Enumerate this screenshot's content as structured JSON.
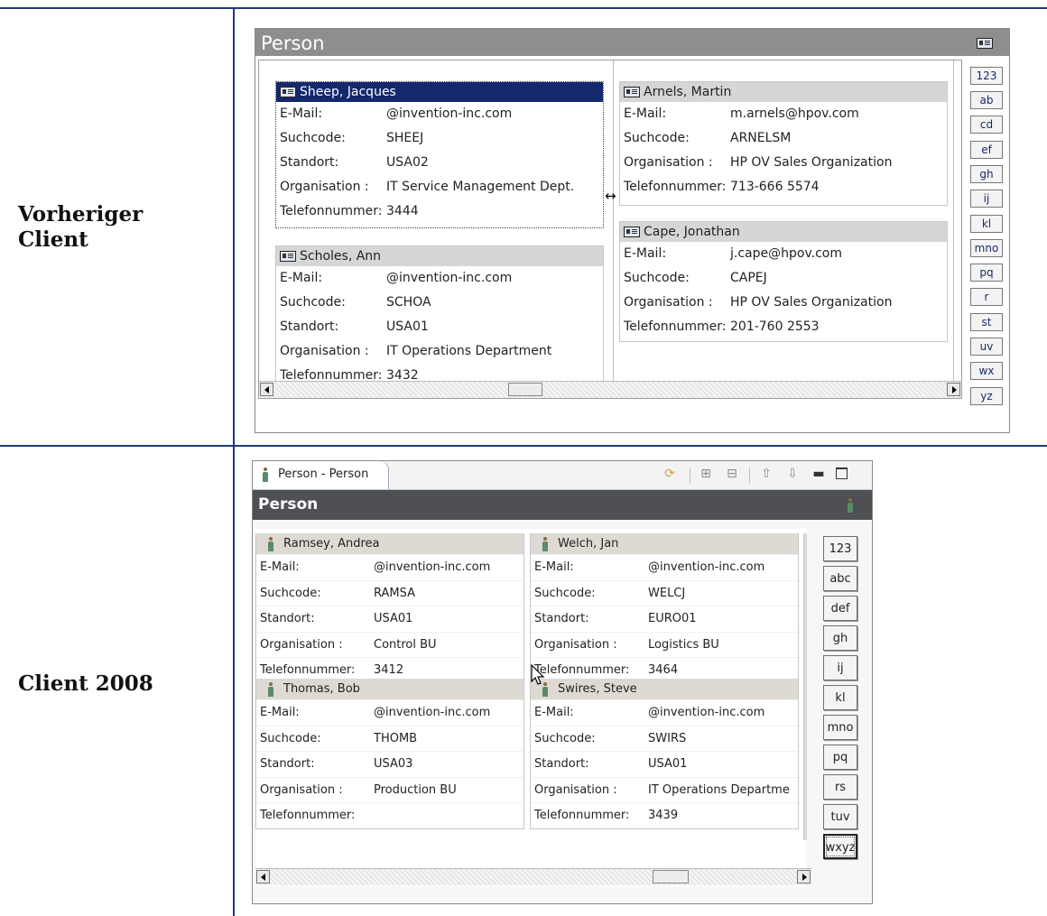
{
  "rows": [
    {
      "label_line1": "Vorheriger",
      "label_line2": "Client"
    },
    {
      "label_line1": "Client 2008"
    }
  ],
  "old_client": {
    "title": "Person",
    "cards": [
      {
        "name": "Sheep, Jacques",
        "selected": true,
        "fields": [
          {
            "k": "E-Mail:",
            "v": "@invention-inc.com"
          },
          {
            "k": "Suchcode:",
            "v": "SHEEJ"
          },
          {
            "k": "Standort:",
            "v": "USA02"
          },
          {
            "k": "Organisation :",
            "v": "IT Service Management Dept."
          },
          {
            "k": "Telefonnummer:",
            "v": "3444"
          }
        ]
      },
      {
        "name": "Scholes, Ann",
        "selected": false,
        "fields": [
          {
            "k": "E-Mail:",
            "v": "@invention-inc.com"
          },
          {
            "k": "Suchcode:",
            "v": "SCHOA"
          },
          {
            "k": "Standort:",
            "v": "USA01"
          },
          {
            "k": "Organisation :",
            "v": "IT Operations Department"
          },
          {
            "k": "Telefonnummer:",
            "v": "3432"
          }
        ]
      },
      {
        "name": "Arnels, Martin",
        "selected": false,
        "fields": [
          {
            "k": "E-Mail:",
            "v": "m.arnels@hpov.com"
          },
          {
            "k": "Suchcode:",
            "v": "ARNELSM"
          },
          {
            "k": "Organisation :",
            "v": "HP OV Sales Organization"
          },
          {
            "k": "Telefonnummer:",
            "v": "713-666 5574"
          }
        ]
      },
      {
        "name": "Cape, Jonathan",
        "selected": false,
        "fields": [
          {
            "k": "E-Mail:",
            "v": "j.cape@hpov.com"
          },
          {
            "k": "Suchcode:",
            "v": "CAPEJ"
          },
          {
            "k": "Organisation :",
            "v": "HP OV Sales Organization"
          },
          {
            "k": "Telefonnummer:",
            "v": "201-760 2553"
          }
        ]
      }
    ],
    "index": [
      "123",
      "ab",
      "cd",
      "ef",
      "gh",
      "ij",
      "kl",
      "mno",
      "pq",
      "r",
      "st",
      "uv",
      "wx",
      "yz"
    ]
  },
  "new_client": {
    "tab_label": "Person - Person",
    "title": "Person",
    "cards": [
      {
        "name": "Ramsey, Andrea",
        "fields": [
          {
            "k": "E-Mail:",
            "v": "@invention-inc.com"
          },
          {
            "k": "Suchcode:",
            "v": "RAMSA"
          },
          {
            "k": "Standort:",
            "v": "USA01"
          },
          {
            "k": "Organisation :",
            "v": "Control BU"
          },
          {
            "k": "Telefonnummer:",
            "v": "3412"
          }
        ]
      },
      {
        "name": "Welch, Jan",
        "fields": [
          {
            "k": "E-Mail:",
            "v": "@invention-inc.com"
          },
          {
            "k": "Suchcode:",
            "v": "WELCJ"
          },
          {
            "k": "Standort:",
            "v": "EURO01"
          },
          {
            "k": "Organisation :",
            "v": "Logistics BU"
          },
          {
            "k": "Telefonnummer:",
            "v": "3464"
          }
        ]
      },
      {
        "name": "Thomas, Bob",
        "fields": [
          {
            "k": "E-Mail:",
            "v": "@invention-inc.com"
          },
          {
            "k": "Suchcode:",
            "v": "THOMB"
          },
          {
            "k": "Standort:",
            "v": "USA03"
          },
          {
            "k": "Organisation :",
            "v": "Production BU"
          },
          {
            "k": "Telefonnummer:",
            "v": ""
          }
        ]
      },
      {
        "name": "Swires, Steve",
        "fields": [
          {
            "k": "E-Mail:",
            "v": "@invention-inc.com"
          },
          {
            "k": "Suchcode:",
            "v": "SWIRS"
          },
          {
            "k": "Standort:",
            "v": "USA01"
          },
          {
            "k": "Organisation :",
            "v": "IT Operations Departme"
          },
          {
            "k": "Telefonnummer:",
            "v": "3439"
          }
        ]
      }
    ],
    "index": [
      "123",
      "abc",
      "def",
      "gh",
      "ij",
      "kl",
      "mno",
      "pq",
      "rs",
      "tuv",
      "wxyz"
    ],
    "active_index": "wxyz",
    "toolbar_icons": [
      "sync-icon",
      "expand-all-icon",
      "collapse-all-icon",
      "move-up-icon",
      "move-down-icon",
      "minimize-icon",
      "maximize-icon"
    ]
  }
}
